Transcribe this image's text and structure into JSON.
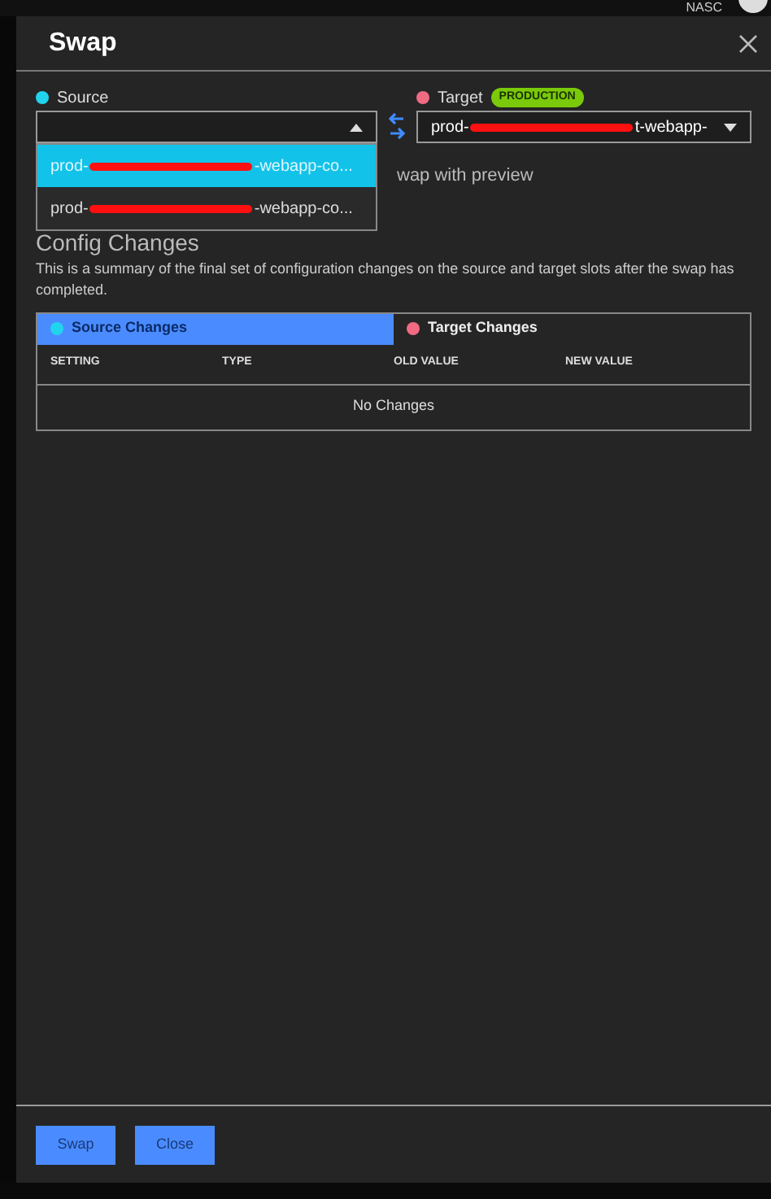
{
  "top_bar": {
    "user": "NASC"
  },
  "blade": {
    "title": "Swap"
  },
  "source": {
    "label": "Source",
    "color": "#22d3ee",
    "expanded": true,
    "options": [
      {
        "prefix": "prod-",
        "suffix": "-webapp-co...",
        "selected": true
      },
      {
        "prefix": "prod-",
        "suffix": "-webapp-co...",
        "selected": false
      }
    ]
  },
  "target": {
    "label": "Target",
    "color": "#f06b82",
    "badge": "PRODUCTION",
    "prefix": "prod-",
    "suffix": "t-webapp-"
  },
  "preview_option": "wap with preview",
  "config": {
    "heading": "Config Changes",
    "description": "This is a summary of the final set of configuration changes on the source and target slots after the swap has completed.",
    "tabs": [
      {
        "label": "Source Changes",
        "color": "#22d3ee",
        "selected": true
      },
      {
        "label": "Target Changes",
        "color": "#f06b82",
        "selected": false
      }
    ],
    "columns": [
      "SETTING",
      "TYPE",
      "OLD VALUE",
      "NEW VALUE"
    ],
    "empty": "No Changes"
  },
  "buttons": [
    "Swap",
    "Close"
  ]
}
